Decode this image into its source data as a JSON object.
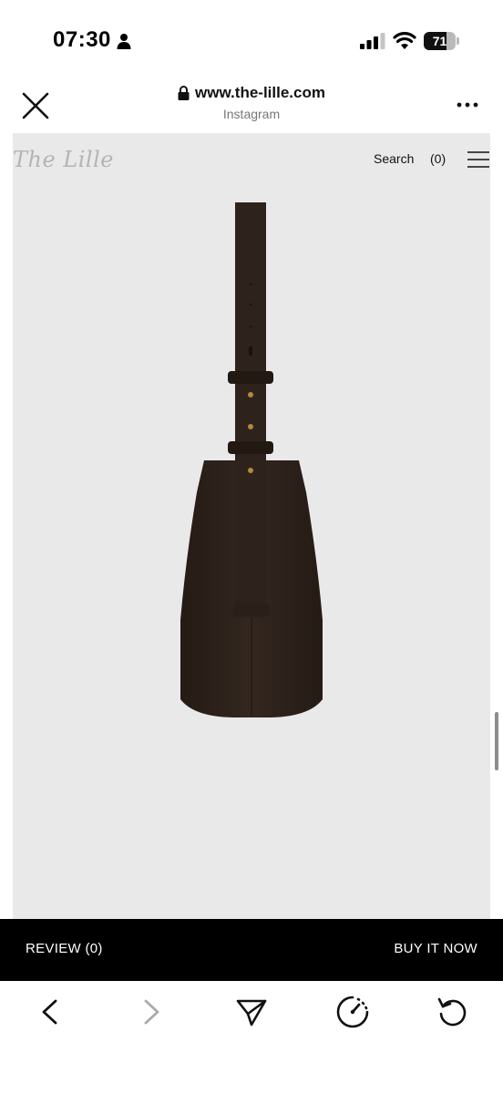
{
  "status_bar": {
    "time": "07:30",
    "battery_percent": 71,
    "battery_label": "71",
    "icons": [
      "person-icon",
      "signal-icon",
      "wifi-icon",
      "battery-icon"
    ]
  },
  "browser": {
    "url": "www.the-lille.com",
    "source": "Instagram",
    "icons": [
      "close-icon",
      "lock-icon",
      "more-icon"
    ]
  },
  "site": {
    "logo": "The Lille",
    "search_label": "Search",
    "cart_label": "(0)",
    "icons": [
      "hamburger-menu-icon"
    ],
    "product_colors": {
      "leather": "#2e231c",
      "hardware": "#b08a3a"
    }
  },
  "actions": {
    "review_label": "REVIEW (0)",
    "buy_label": "BUY IT NOW"
  },
  "toolbar": {
    "icons": [
      "back-icon",
      "forward-icon",
      "share-icon",
      "speed-icon",
      "reload-icon"
    ]
  },
  "colors": {
    "page_bg": "#e9e9e9",
    "action_bar": "#000000",
    "product": "#2e231c"
  }
}
